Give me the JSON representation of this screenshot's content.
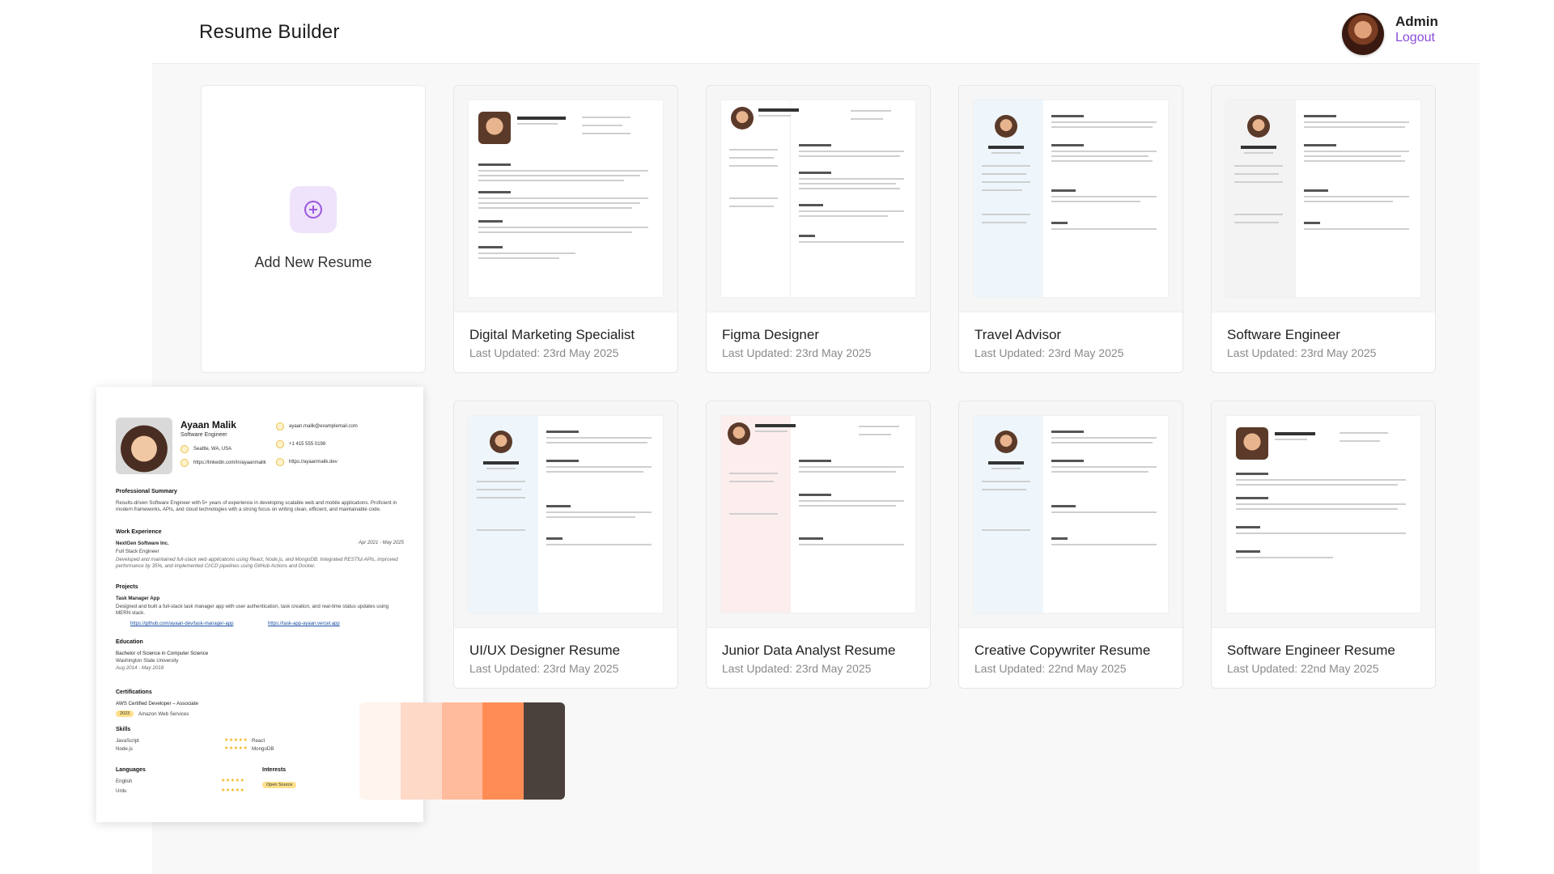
{
  "header": {
    "title": "Resume Builder",
    "user_name": "Admin",
    "logout_label": "Logout"
  },
  "add_card": {
    "label": "Add New Resume"
  },
  "resumes": [
    {
      "title": "Digital Marketing Specialist",
      "updated": "Last Updated: 23rd May 2025"
    },
    {
      "title": "Figma Designer",
      "updated": "Last Updated: 23rd May 2025"
    },
    {
      "title": "Travel Advisor",
      "updated": "Last Updated: 23rd May 2025"
    },
    {
      "title": "Software Engineer",
      "updated": "Last Updated: 23rd May 2025"
    },
    {
      "title": "UI/UX Designer Resume",
      "updated": "Last Updated: 23rd May 2025"
    },
    {
      "title": "Junior Data Analyst Resume",
      "updated": "Last Updated: 23rd May 2025"
    },
    {
      "title": "Creative Copywriter Resume",
      "updated": "Last Updated: 22nd May 2025"
    },
    {
      "title": "Software Engineer Resume",
      "updated": "Last Updated: 22nd May 2025"
    }
  ],
  "preview": {
    "name": "Ayaan Malik",
    "role": "Software Engineer",
    "location": "Seattle, WA, USA",
    "linkedin": "https://linkedin.com/in/ayaanmalik",
    "email": "ayaan.malik@examplemail.com",
    "phone": "+1 415 555 0198",
    "website": "https://ayaanmalik.dev",
    "summary_heading": "Professional Summary",
    "summary": "Results-driven Software Engineer with 5+ years of experience in developing scalable web and mobile applications. Proficient in modern frameworks, APIs, and cloud technologies with a strong focus on writing clean, efficient, and maintainable code.",
    "experience_heading": "Work Experience",
    "company": "NextGen Software Inc.",
    "job_title": "Full Stack Engineer",
    "job_dates": "Apr 2021 - May 2025",
    "job_desc": "Developed and maintained full-stack web applications using React, Node.js, and MongoDB. Integrated RESTful APIs, improved performance by 35%, and implemented CI/CD pipelines using GitHub Actions and Docker.",
    "projects_heading": "Projects",
    "project_name": "Task Manager App",
    "project_desc": "Designed and built a full-stack task manager app with user authentication, task creation, and real-time status updates using MERN stack.",
    "project_link1": "https://github.com/ayaan-dev/task-manager-app",
    "project_link2": "https://task-app-ayaan.vercel.app",
    "education_heading": "Education",
    "degree": "Bachelor of Science in Computer Science",
    "school": "Washington State University",
    "edu_dates": "Aug 2014 - May 2018",
    "certs_heading": "Certifications",
    "cert_name": "AWS Certified Developer – Associate",
    "cert_year": "2023",
    "cert_issuer": "Amazon Web Services",
    "skills_heading": "Skills",
    "skill1": "JavaScript",
    "skill2": "Node.js",
    "skill3": "React",
    "skill4": "MongoDB",
    "languages_heading": "Languages",
    "lang1": "English",
    "lang2": "Urdu",
    "interests_heading": "Interests",
    "interest1": "Open Source"
  },
  "palette": {
    "colors": [
      "#fff4ee",
      "#ffd9c7",
      "#ffbb9c",
      "#ff8c55",
      "#4a403c"
    ]
  }
}
